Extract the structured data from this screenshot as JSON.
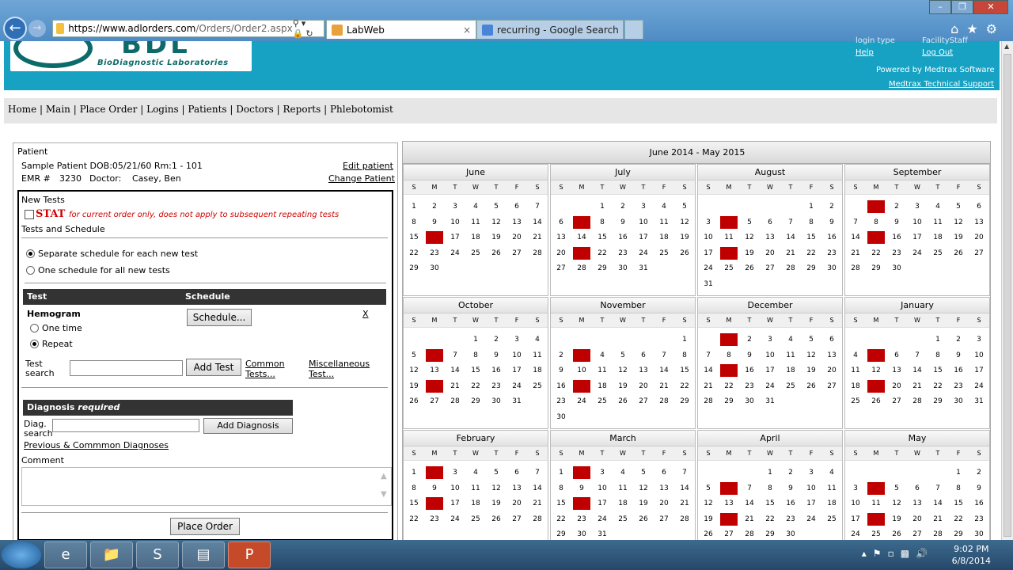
{
  "browser": {
    "url_host": "https://www.adlorders.com",
    "url_path": "/Orders/Order2.aspx",
    "tabs": [
      {
        "label": "LabWeb"
      },
      {
        "label": "recurring - Google Search"
      }
    ]
  },
  "header": {
    "logo_big": "BDL",
    "logo_text": "BioDiagnostic Laboratories",
    "login_type": "login type",
    "facility": "FacilityStaff",
    "help": "Help",
    "logout": "Log Out",
    "powered": "Powered by Medtrax Software",
    "support": "Medtrax Technical Support"
  },
  "nav": {
    "home": "Home",
    "main": "Main",
    "place_order": "Place Order",
    "logins": "Logins",
    "patients": "Patients",
    "doctors": "Doctors",
    "reports": "Reports",
    "phlebotomist": "Phlebotomist",
    "sep": "|"
  },
  "patient": {
    "section": "Patient",
    "info": "Sample Patient DOB:05/21/60 Rm:1 - 101",
    "emr_label": "EMR #",
    "emr": "3230",
    "doctor_label": "Doctor:",
    "doctor": "Casey, Ben",
    "edit": "Edit patient",
    "change": "Change Patient"
  },
  "tests": {
    "new_tests": "New Tests",
    "stat": "STAT",
    "stat_note": "for current order only, does not apply to subsequent repeating tests",
    "tests_schedule": "Tests and Schedule",
    "opt_separate": "Separate schedule for each new test",
    "opt_one": "One schedule for all new tests",
    "col_test": "Test",
    "col_schedule": "Schedule",
    "test_name": "Hemogram",
    "one_time": "One time",
    "repeat": "Repeat",
    "schedule_btn": "Schedule...",
    "remove": "X",
    "search_label_1": "Test",
    "search_label_2": "search",
    "add_test": "Add Test",
    "common_1": "Common",
    "common_2": "Tests...",
    "misc_1": "Miscellaneous",
    "misc_2": "Test...",
    "diag_header": "Diagnosis",
    "diag_required": "required",
    "diag_label_1": "Diag.",
    "diag_label_2": "search",
    "add_diag": "Add Diagnosis",
    "prev_diag": "Previous & Commmon Diagnoses",
    "comment": "Comment",
    "place_order": "Place Order"
  },
  "calendar": {
    "title": "June 2014 - May 2015",
    "dow": [
      "S",
      "M",
      "T",
      "W",
      "T",
      "F",
      "S"
    ],
    "months": [
      {
        "name": "June",
        "start": 0,
        "days": 30,
        "red": [
          16
        ]
      },
      {
        "name": "July",
        "start": 2,
        "days": 31,
        "red": [
          7,
          21
        ]
      },
      {
        "name": "August",
        "start": 5,
        "days": 31,
        "red": [
          4,
          18
        ]
      },
      {
        "name": "September",
        "start": 1,
        "days": 30,
        "red": [
          1,
          15
        ]
      },
      {
        "name": "October",
        "start": 3,
        "days": 31,
        "red": [
          6,
          20
        ]
      },
      {
        "name": "November",
        "start": 6,
        "days": 30,
        "red": [
          3,
          17
        ]
      },
      {
        "name": "December",
        "start": 1,
        "days": 31,
        "red": [
          1,
          15
        ]
      },
      {
        "name": "January",
        "start": 4,
        "days": 31,
        "red": [
          5,
          19
        ]
      },
      {
        "name": "February",
        "start": 0,
        "days": 28,
        "red": [
          2,
          16
        ]
      },
      {
        "name": "March",
        "start": 0,
        "days": 31,
        "red": [
          2,
          16
        ]
      },
      {
        "name": "April",
        "start": 3,
        "days": 30,
        "red": [
          6,
          20
        ]
      },
      {
        "name": "May",
        "start": 5,
        "days": 31,
        "red": [
          4,
          18
        ]
      }
    ]
  },
  "taskbar": {
    "time": "9:02 PM",
    "date": "6/8/2014"
  }
}
